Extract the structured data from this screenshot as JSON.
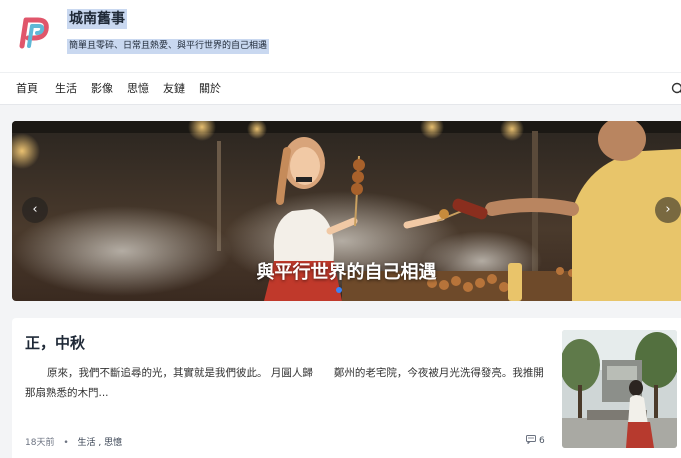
{
  "site": {
    "title": "城南舊事",
    "description": "簡單且零碎、日常且熱愛、與平行世界的自己相遇"
  },
  "nav": {
    "items": [
      "首頁",
      "生活",
      "影像",
      "思憶",
      "友鏈",
      "關於"
    ]
  },
  "slider": {
    "caption": "與平行世界的自己相遇",
    "prev_label": "‹",
    "next_label": "›"
  },
  "post": {
    "title": "正，中秋",
    "excerpt": "原來，我們不斷追尋的光，其實就是我們彼此。 月圓人歸　　鄭州的老宅院，今夜被月光洗得發亮。我推開那扇熟悉的木門...",
    "time": "18天前",
    "categories": "生活 , 思憶",
    "comment_count": "6"
  }
}
